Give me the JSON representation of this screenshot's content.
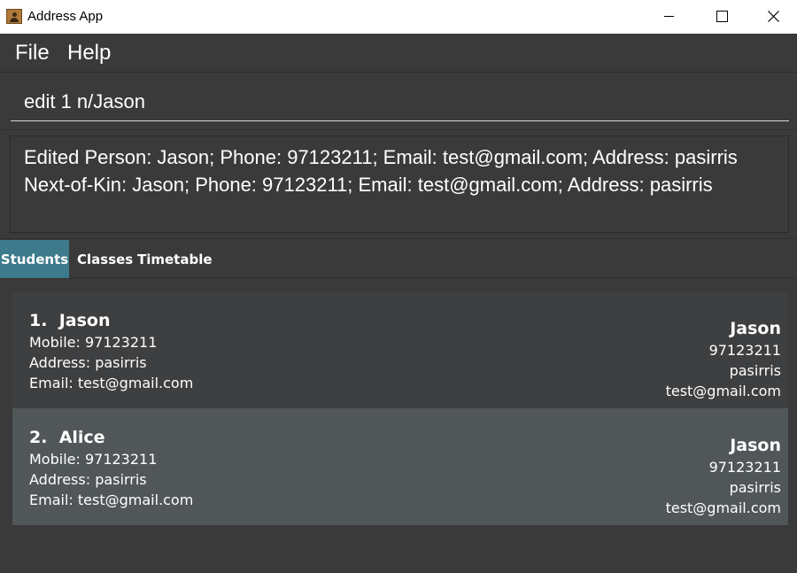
{
  "window": {
    "title": "Address App",
    "icon": "address-book-icon"
  },
  "menu": {
    "items": [
      "File",
      "Help"
    ]
  },
  "command": {
    "value": "edit 1 n/Jason"
  },
  "result": {
    "lines": [
      "Edited Person: Jason; Phone: 97123211; Email: test@gmail.com; Address: pasirris",
      "Next-of-Kin: Jason; Phone: 97123211; Email: test@gmail.com; Address: pasirris"
    ]
  },
  "tabs": [
    {
      "label": "Students",
      "selected": true
    },
    {
      "label": "Classes",
      "selected": false
    },
    {
      "label": "Timetable",
      "selected": false
    }
  ],
  "persons": [
    {
      "index": "1.",
      "name": "Jason",
      "mobile": "Mobile: 97123211",
      "address": "Address: pasirris",
      "email": "Email: test@gmail.com",
      "kin": {
        "name": "Jason",
        "phone": "97123211",
        "address": "pasirris",
        "email": "test@gmail.com"
      }
    },
    {
      "index": "2.",
      "name": "Alice",
      "mobile": "Mobile: 97123211",
      "address": "Address: pasirris",
      "email": "Email: test@gmail.com",
      "kin": {
        "name": "Jason",
        "phone": "97123211",
        "address": "pasirris",
        "email": "test@gmail.com"
      }
    }
  ],
  "colors": {
    "background": "#3a3a3a",
    "selected_tab": "#3c7a8c",
    "card_default": "#3e3f41",
    "card_selected": "#515658"
  }
}
